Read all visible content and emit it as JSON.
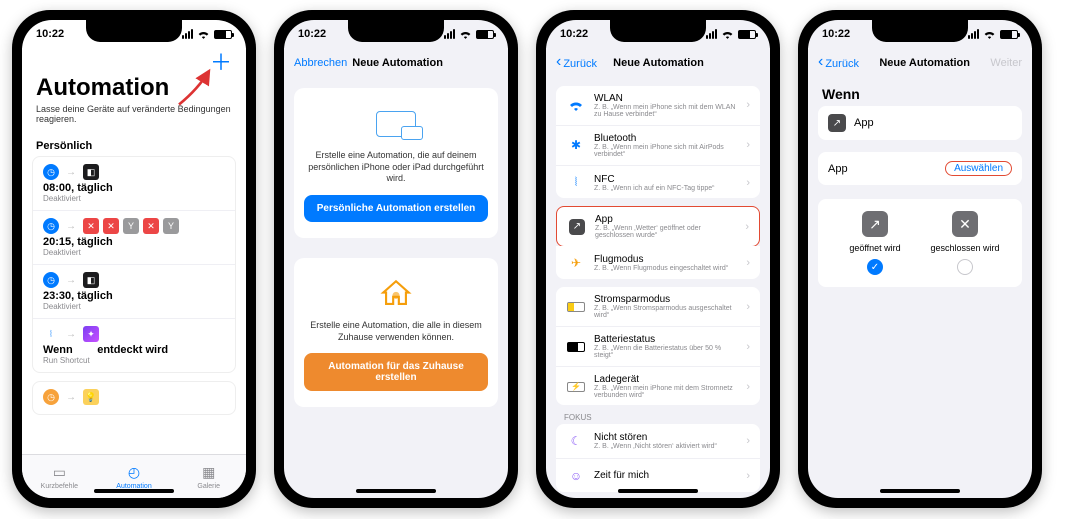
{
  "status": {
    "time": "10:22"
  },
  "phone1": {
    "title": "Automation",
    "subtitle": "Lasse deine Geräte auf veränderte Bedingungen reagieren.",
    "section": "Persönlich",
    "items": [
      {
        "title": "08:00, täglich",
        "sub": "Deaktiviert"
      },
      {
        "title": "20:15, täglich",
        "sub": "Deaktiviert"
      },
      {
        "title": "23:30, täglich",
        "sub": "Deaktiviert"
      },
      {
        "title": "Wenn",
        "extra": "entdeckt wird",
        "sub": "Run Shortcut"
      }
    ],
    "tabs": {
      "shortcuts": "Kurzbefehle",
      "automation": "Automation",
      "gallery": "Galerie"
    }
  },
  "phone2": {
    "cancel": "Abbrechen",
    "title": "Neue Automation",
    "personal_desc": "Erstelle eine Automation, die auf deinem persönlichen iPhone oder iPad durchgeführt wird.",
    "personal_btn": "Persönliche Automation erstellen",
    "home_desc": "Erstelle eine Automation, die alle in diesem Zuhause verwenden können.",
    "home_btn": "Automation für das Zuhause erstellen"
  },
  "phone3": {
    "back": "Zurück",
    "title": "Neue Automation",
    "triggers": [
      {
        "icon": "wifi",
        "color": "#007aff",
        "title": "WLAN",
        "sub": "Z. B. „Wenn mein iPhone sich mit dem WLAN zu Hause verbindet“"
      },
      {
        "icon": "bt",
        "color": "#007aff",
        "title": "Bluetooth",
        "sub": "Z. B. „Wenn mein iPhone sich mit AirPods verbindet“"
      },
      {
        "icon": "nfc",
        "color": "#007aff",
        "title": "NFC",
        "sub": "Z. B. „Wenn ich auf ein NFC-Tag tippe“"
      },
      {
        "icon": "app",
        "color": "#4a4a4c",
        "title": "App",
        "sub": "Z. B. „Wenn ‚Wetter‘ geöffnet oder geschlossen wurde“",
        "hl": true
      },
      {
        "icon": "plane",
        "color": "#f59e0b",
        "title": "Flugmodus",
        "sub": "Z. B. „Wenn Flugmodus eingeschaltet wird“"
      },
      {
        "icon": "lpm",
        "color": "#facc15",
        "title": "Stromsparmodus",
        "sub": "Z. B. „Wenn Stromsparmodus ausgeschaltet wird“"
      },
      {
        "icon": "bat",
        "color": "#000",
        "title": "Batteriestatus",
        "sub": "Z. B. „Wenn die Batteriestatus über 50 % steigt“"
      },
      {
        "icon": "chg",
        "color": "#22c55e",
        "title": "Ladegerät",
        "sub": "Z. B. „Wenn mein iPhone mit dem Stromnetz verbunden wird“"
      }
    ],
    "focus_header": "FOKUS",
    "focus": [
      {
        "icon": "moon",
        "color": "#8b5cf6",
        "title": "Nicht stören",
        "sub": "Z. B. „Wenn ‚Nicht stören‘ aktiviert wird“"
      },
      {
        "icon": "me",
        "color": "#8b5cf6",
        "title": "Zeit für mich",
        "sub": ""
      }
    ]
  },
  "phone4": {
    "back": "Zurück",
    "title": "Neue Automation",
    "next": "Weiter",
    "wenn": "Wenn",
    "app_label": "App",
    "choose": "Auswählen",
    "opt_open": "geöffnet wird",
    "opt_close": "geschlossen wird"
  }
}
